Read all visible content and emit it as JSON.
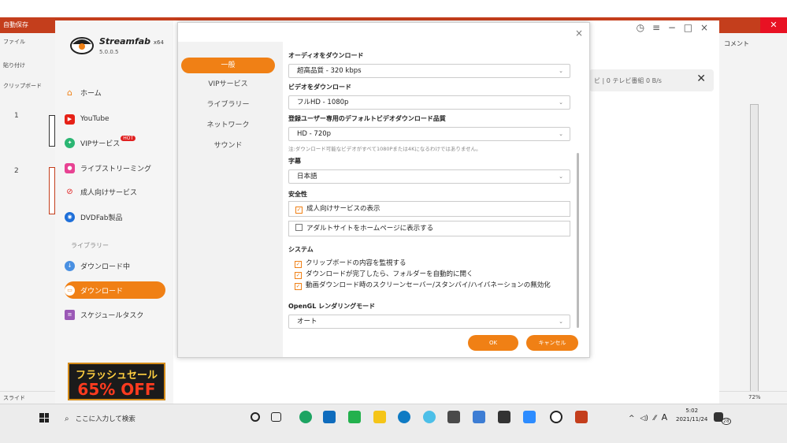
{
  "powerpoint": {
    "title_text": "自動保存",
    "ribbon_tab": "ファイル",
    "paste_label": "貼り付け",
    "clipboard_label": "クリップボード",
    "slide_numbers": [
      "1",
      "2"
    ],
    "comment_label": "コメント",
    "status_left": "スライド",
    "zoom": "72%"
  },
  "streamfab": {
    "brand": "Streamfab",
    "arch": "x64",
    "version": "5.0.0.5",
    "nav": [
      {
        "label": "ホーム",
        "icon": "home-icon"
      },
      {
        "label": "YouTube",
        "icon": "youtube-icon"
      },
      {
        "label": "VIPサービス",
        "icon": "vip-icon",
        "badge": "HOT"
      },
      {
        "label": "ライブストリーミング",
        "icon": "live-icon"
      },
      {
        "label": "成人向けサービス",
        "icon": "adult-icon"
      },
      {
        "label": "DVDFab製品",
        "icon": "dvdfab-icon"
      }
    ],
    "library_heading": "ライブラリー",
    "library": [
      {
        "label": "ダウンロード中",
        "icon": "downloading-icon"
      },
      {
        "label": "ダウンロード",
        "icon": "download-folder-icon",
        "active": true
      },
      {
        "label": "スケジュールタスク",
        "icon": "schedule-icon"
      }
    ],
    "sale_line1": "フラッシュセール",
    "sale_line2": "65% OFF",
    "download_status": "ビ | 0 テレビ番組   0 B/s"
  },
  "settings": {
    "tabs": [
      "一般",
      "VIPサービス",
      "ライブラリー",
      "ネットワーク",
      "サウンド"
    ],
    "active_tab": "一般",
    "audio_label": "オーディオをダウンロード",
    "audio_value": "超高品質 - 320 kbps",
    "video_label": "ビデオをダウンロード",
    "video_value": "フルHD - 1080p",
    "registered_label": "登録ユーザー専用のデフォルトビデオダウンロード品質",
    "registered_value": "HD - 720p",
    "registered_note": "注:ダウンロード可能なビデオがすべて1080Pまたは4Kになるわけではありません。",
    "subtitle_label": "字幕",
    "subtitle_value": "日本語",
    "safety_label": "安全性",
    "safety_options": [
      {
        "label": "成人向けサービスの表示",
        "checked": true
      },
      {
        "label": "アダルトサイトをホームページに表示する",
        "checked": false
      }
    ],
    "system_label": "システム",
    "system_options": [
      {
        "label": "クリップボードの内容を監視する",
        "checked": true
      },
      {
        "label": "ダウンロードが完了したら、フォルダーを自動的に開く",
        "checked": true
      },
      {
        "label": "動画ダウンロード時のスクリーンセーバー/スタンバイ/ハイバネーションの無効化",
        "checked": true
      }
    ],
    "opengl_label": "OpenGL レンダリングモード",
    "opengl_value": "オート",
    "ok_label": "OK",
    "cancel_label": "キャンセル"
  },
  "taskbar": {
    "search_placeholder": "ここに入力して検索",
    "tray_ime": "A",
    "time": "5:02",
    "date": "2021/11/24",
    "notification_count": "28"
  },
  "colors": {
    "accent": "#f08015",
    "ppt_red": "#c43e1c"
  }
}
